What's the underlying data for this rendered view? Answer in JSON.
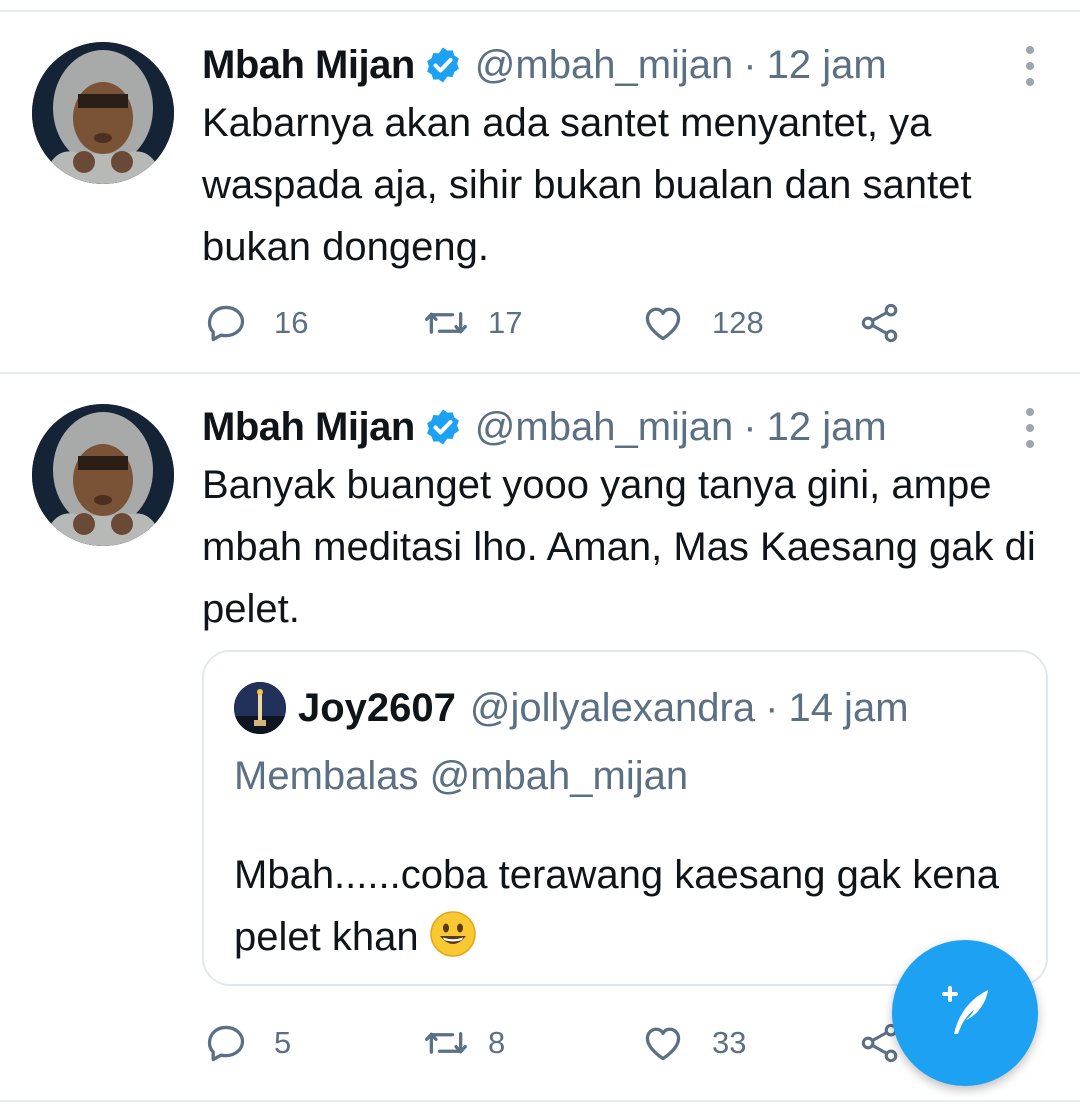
{
  "feed": {
    "tweets": [
      {
        "author_name": "Mbah Mijan",
        "author_handle": "@mbah_mijan",
        "separator": "·",
        "time": "12 jam",
        "text": "Kabarnya akan ada santet menyantet, ya waspada aja, sihir bukan bualan dan santet bukan dongeng.",
        "reply_count": "16",
        "retweet_count": "17",
        "like_count": "128"
      },
      {
        "author_name": "Mbah Mijan",
        "author_handle": "@mbah_mijan",
        "separator": "·",
        "time": "12 jam",
        "text": "Banyak buanget yooo yang tanya gini, ampe mbah meditasi lho. Aman, Mas Kaesang gak di pelet.",
        "reply_count": "5",
        "retweet_count": "8",
        "like_count": "33",
        "quoted": {
          "author_name": "Joy2607",
          "author_handle": "@jollyalexandra",
          "separator": "·",
          "time": "14 jam",
          "reply_to": "Membalas @mbah_mijan",
          "text": "Mbah......coba terawang kaesang gak kena pelet khan",
          "emoji": "grinning-face"
        }
      }
    ]
  },
  "icons": {
    "verified": "verified-badge-icon",
    "more": "more-vertical-icon",
    "reply": "reply-icon",
    "retweet": "retweet-icon",
    "like": "heart-icon",
    "share": "share-icon",
    "compose": "compose-tweet-icon"
  },
  "colors": {
    "accent": "#1da1f2",
    "secondary_text": "#5b7083",
    "divider": "#e6ecf0"
  }
}
